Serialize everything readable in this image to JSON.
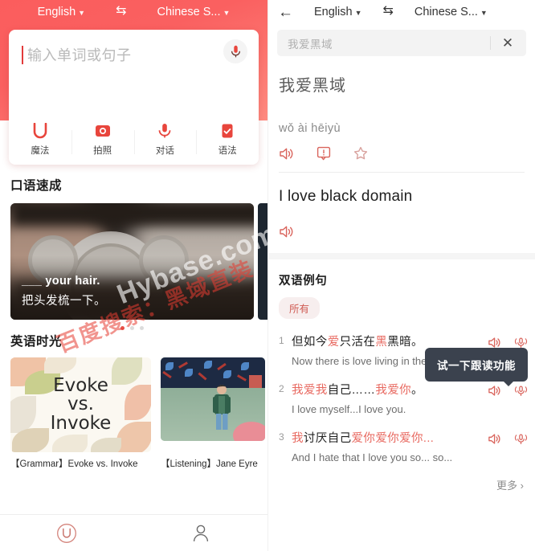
{
  "left": {
    "source_lang": "English",
    "target_lang": "Chinese S...",
    "swap_icon": "swap-horizontal-icon",
    "input_placeholder": "输入单词或句子",
    "mic_icon": "microphone-icon",
    "actions": [
      {
        "label": "魔法",
        "icon": "magic-u-icon"
      },
      {
        "label": "拍照",
        "icon": "camera-icon"
      },
      {
        "label": "对话",
        "icon": "microphone-icon"
      },
      {
        "label": "语法",
        "icon": "grammar-document-icon"
      }
    ],
    "section1_title": "口语速成",
    "carousel": {
      "caption_en": "___ your hair.",
      "caption_zh": "把头发梳一下。",
      "dots": 3,
      "active_dot": 1
    },
    "section2_title": "英语时光",
    "tiles": [
      {
        "art_text_1": "Evoke",
        "art_text_2": "vs.",
        "art_text_3": "Invoke",
        "caption": "【Grammar】Evoke vs. Invoke"
      },
      {
        "caption": "【Listening】Jane Eyre"
      }
    ],
    "bottom_nav": [
      {
        "icon": "u-logo-icon",
        "label": ""
      },
      {
        "icon": "person-icon",
        "label": ""
      }
    ]
  },
  "right": {
    "back_icon": "arrow-left-icon",
    "source_lang": "English",
    "target_lang": "Chinese S...",
    "swap_icon": "swap-horizontal-icon",
    "search_value": "我爱黑域",
    "clear_icon": "close-x-icon",
    "source_text": "我爱黑域",
    "pinyin": "wǒ ài hēiyù",
    "source_actions": [
      {
        "icon": "speaker-icon"
      },
      {
        "icon": "feedback-icon"
      },
      {
        "icon": "star-icon"
      }
    ],
    "target_text": "I love black domain",
    "target_actions": [
      {
        "icon": "speaker-icon"
      }
    ],
    "examples_title": "双语例句",
    "filter_chip": "所有",
    "tooltip": "试一下跟读功能",
    "examples": [
      {
        "num": "1",
        "zh_parts": [
          {
            "t": "但如今",
            "hl": false
          },
          {
            "t": "爱",
            "hl": true
          },
          {
            "t": "只活在",
            "hl": false
          },
          {
            "t": "黑",
            "hl": true
          },
          {
            "t": "黑暗。",
            "hl": false
          }
        ],
        "en": "Now there is love living in the dark."
      },
      {
        "num": "2",
        "zh_parts": [
          {
            "t": "我爱我",
            "hl": true
          },
          {
            "t": "自己……",
            "hl": false
          },
          {
            "t": "我爱你",
            "hl": true
          },
          {
            "t": "。",
            "hl": false
          }
        ],
        "en": "I love myself...I love you."
      },
      {
        "num": "3",
        "zh_parts": [
          {
            "t": "我",
            "hl": true
          },
          {
            "t": "讨厌自己",
            "hl": false
          },
          {
            "t": "爱你爱你爱你...",
            "hl": true
          }
        ],
        "en": "And I hate that I love you so... so..."
      }
    ],
    "example_actions": [
      {
        "icon": "speaker-icon"
      },
      {
        "icon": "record-mic-icon"
      }
    ],
    "more_label": "更多",
    "more_icon": "chevron-right-icon"
  },
  "watermarks": {
    "line1": "百度搜索：黑域直装",
    "line2": "Hybase.com"
  },
  "colors": {
    "brand_red": "#fa5f5f",
    "accent": "#e8574f",
    "tooltip_bg": "#3b424e"
  }
}
